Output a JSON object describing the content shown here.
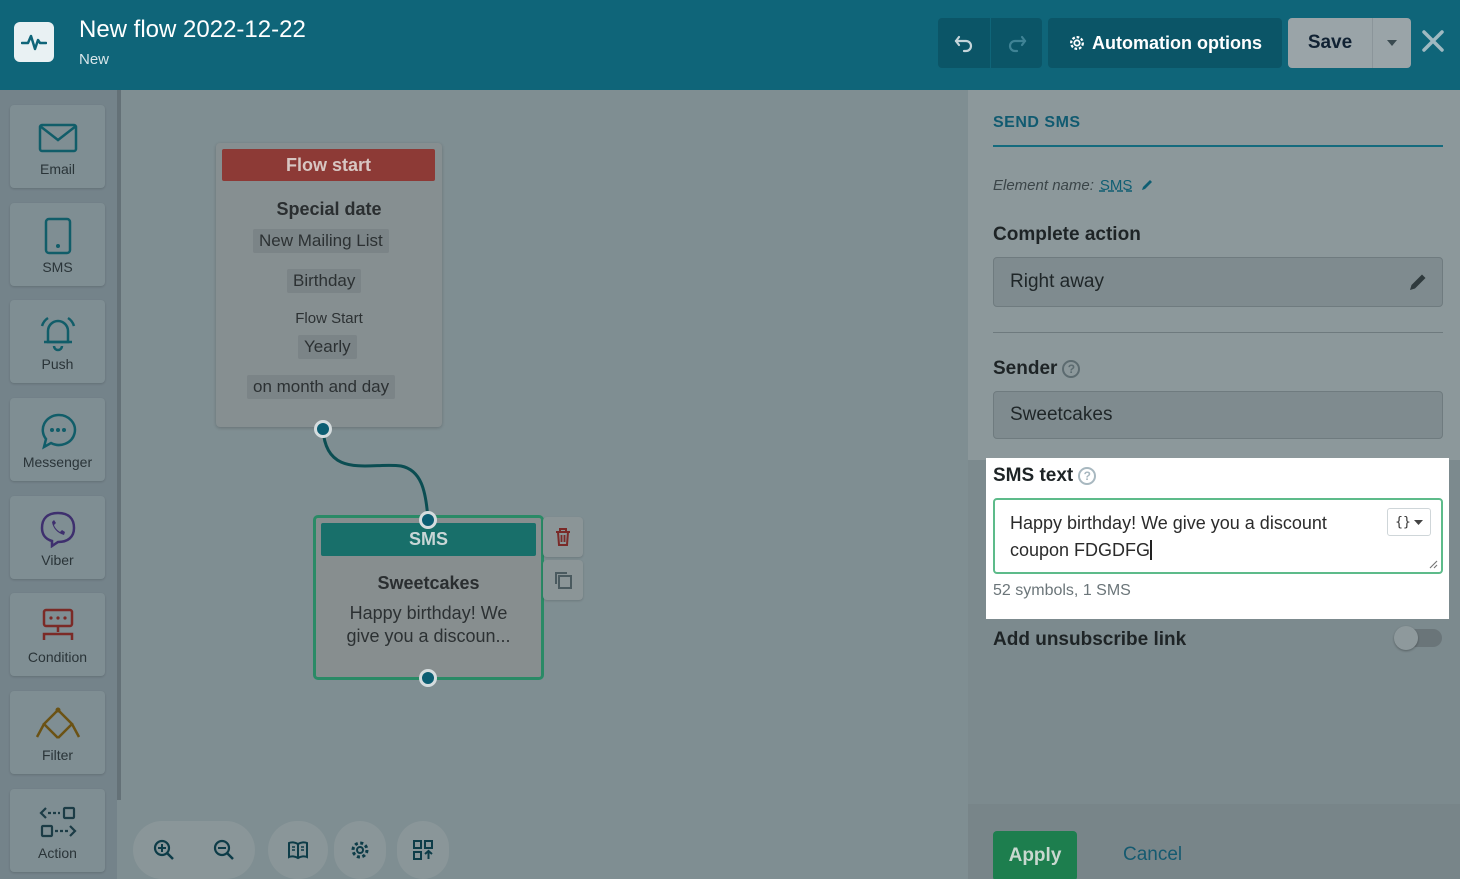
{
  "header": {
    "title": "New flow 2022-12-22",
    "status": "New",
    "automation_options_label": "Automation options",
    "save_label": "Save"
  },
  "palette": [
    {
      "label": "Email",
      "icon": "email-icon"
    },
    {
      "label": "SMS",
      "icon": "phone-icon"
    },
    {
      "label": "Push",
      "icon": "bell-icon"
    },
    {
      "label": "Messenger",
      "icon": "chat-icon"
    },
    {
      "label": "Viber",
      "icon": "viber-icon"
    },
    {
      "label": "Condition",
      "icon": "condition-icon"
    },
    {
      "label": "Filter",
      "icon": "filter-icon"
    },
    {
      "label": "Action",
      "icon": "action-icon"
    }
  ],
  "flow_start": {
    "header": "Flow start",
    "type": "Special date",
    "list": "New Mailing List",
    "field": "Birthday",
    "start_label": "Flow Start",
    "frequency": "Yearly",
    "match": "on month and day"
  },
  "sms_node": {
    "header": "SMS",
    "sender": "Sweetcakes",
    "preview": "Happy birthday! We give you a discoun..."
  },
  "panel": {
    "title": "SEND SMS",
    "element_name_label": "Element name:",
    "element_name": "SMS",
    "complete_action_label": "Complete action",
    "complete_action_value": "Right away",
    "sender_label": "Sender",
    "sender_value": "Sweetcakes",
    "sms_text_label": "SMS text",
    "sms_text_value": "Happy birthday! We give you a discount coupon FDGDFG",
    "counter": "52 symbols, 1 SMS",
    "unsubscribe_label": "Add unsubscribe link",
    "unsubscribe_enabled": false,
    "apply_label": "Apply",
    "cancel_label": "Cancel"
  },
  "colors": {
    "header_bg": "#0f6579",
    "accent_green": "#1d7e4e",
    "flow_start_red": "#8d3a36",
    "sms_teal": "#186f6a"
  }
}
